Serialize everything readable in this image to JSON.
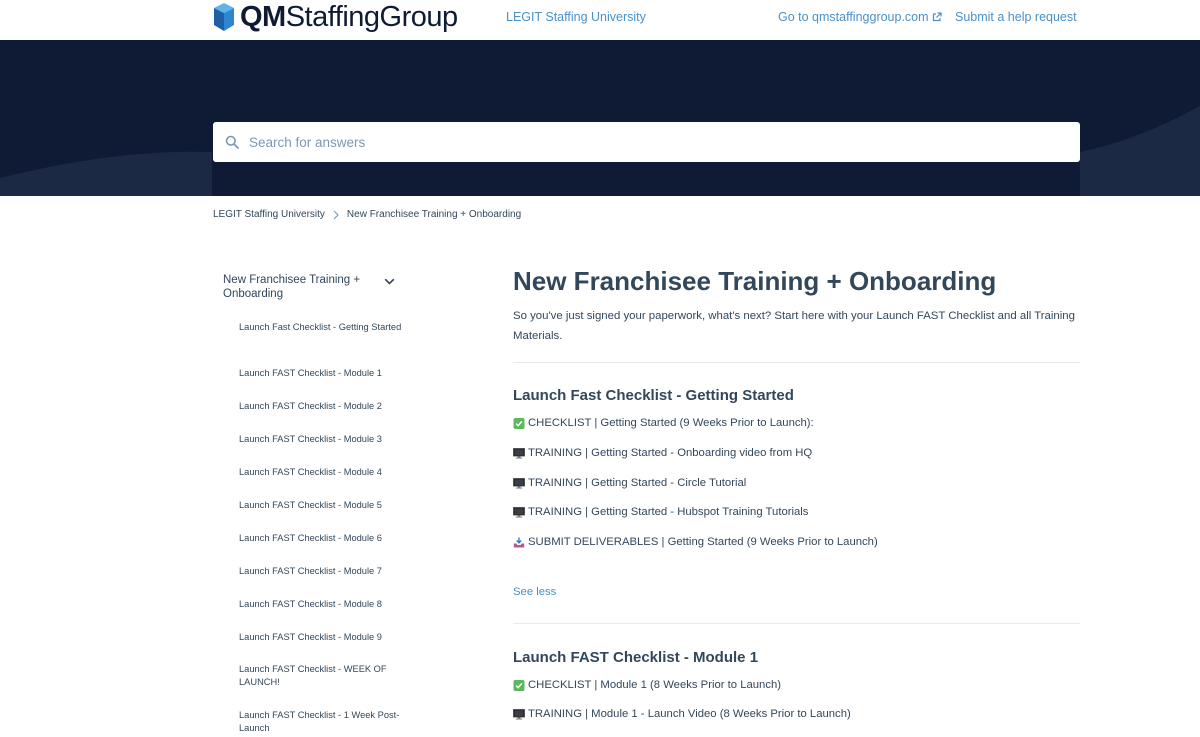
{
  "header": {
    "logo": {
      "prefix": "QM",
      "suffix": "StaffingGroup"
    },
    "university_link": "LEGIT Staffing University",
    "site_link": "Go to qmstaffinggroup.com",
    "help_link": "Submit a help request"
  },
  "search": {
    "placeholder": "Search for answers"
  },
  "breadcrumb": [
    "LEGIT Staffing University",
    "New Franchisee Training + Onboarding"
  ],
  "sidebar": {
    "heading": "New Franchisee Training + Onboarding",
    "items": [
      "Launch Fast Checklist - Getting Started",
      "Launch FAST Checklist - Module 1",
      "Launch FAST Checklist - Module 2",
      "Launch FAST Checklist - Module 3",
      "Launch FAST Checklist - Module 4",
      "Launch FAST Checklist - Module 5",
      "Launch FAST Checklist - Module 6",
      "Launch FAST Checklist - Module 7",
      "Launch FAST Checklist - Module 8",
      "Launch FAST Checklist - Module 9",
      "Launch FAST Checklist - WEEK OF LAUNCH!",
      "Launch FAST Checklist - 1 Week Post-Launch"
    ]
  },
  "main": {
    "title": "New Franchisee Training + Onboarding",
    "description": "So you've just signed your paperwork, what's next? Start here with your Launch FAST Checklist and all Training Materials.",
    "see_less": "See less",
    "sections": [
      {
        "title": "Launch Fast Checklist - Getting Started",
        "articles": [
          {
            "icon": "checkmark-icon",
            "text": "CHECKLIST | Getting Started (9 Weeks Prior to Launch):"
          },
          {
            "icon": "monitor-icon",
            "text": "TRAINING | Getting Started - Onboarding video from HQ"
          },
          {
            "icon": "monitor-icon",
            "text": "TRAINING | Getting Started - Circle Tutorial"
          },
          {
            "icon": "monitor-icon",
            "text": "TRAINING | Getting Started - Hubspot Training Tutorials"
          },
          {
            "icon": "inbox-tray-icon",
            "text": "SUBMIT DELIVERABLES | Getting Started (9 Weeks Prior to Launch)"
          }
        ]
      },
      {
        "title": "Launch FAST Checklist - Module 1",
        "articles": [
          {
            "icon": "checkmark-icon",
            "text": "CHECKLIST | Module 1 (8 Weeks Prior to Launch)"
          },
          {
            "icon": "monitor-icon",
            "text": "TRAINING | Module 1 - Launch Video (8 Weeks Prior to Launch)"
          }
        ]
      }
    ]
  },
  "colors": {
    "navy": "#0f1b35",
    "link_blue": "#4a90c8",
    "text": "#33475b",
    "check_green": "#5cb85c"
  }
}
